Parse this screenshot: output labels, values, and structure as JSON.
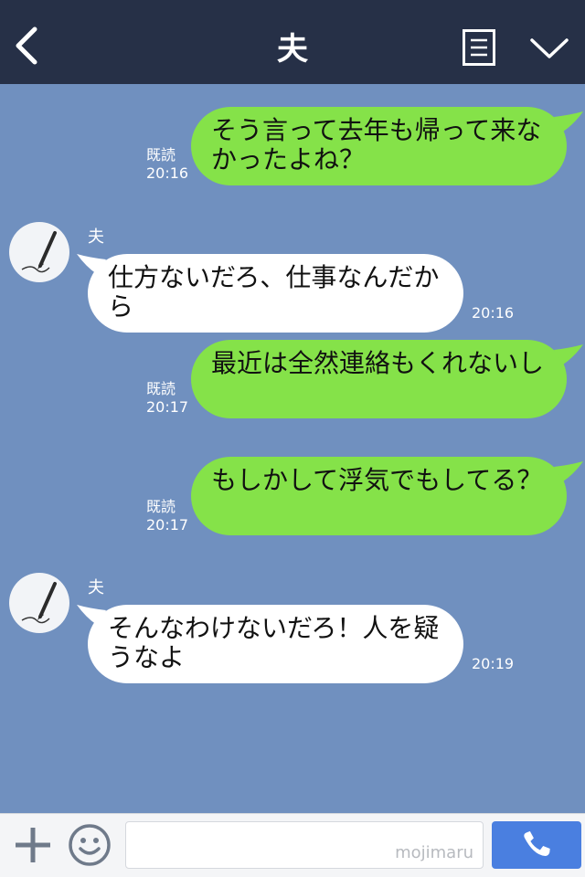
{
  "header": {
    "title": "夫"
  },
  "messages": [
    {
      "text": "そう言って去年も帰って来なかったよね？",
      "read": "既読",
      "time": "20:16"
    },
    {
      "sender": "夫",
      "text": "仕方ないだろ、仕事なんだから",
      "time": "20:16"
    },
    {
      "text": "最近は全然連絡もくれないし",
      "read": "既読",
      "time": "20:17"
    },
    {
      "text": "もしかして浮気でもしてる？",
      "read": "既読",
      "time": "20:17"
    },
    {
      "sender": "夫",
      "text": "そんなわけないだろ！人を疑うなよ",
      "time": "20:19"
    }
  ],
  "input": {
    "watermark": "mojimaru"
  },
  "colors": {
    "header": "#263047",
    "background": "#7090bf",
    "sent_bubble": "#85e249",
    "received_bubble": "#ffffff",
    "call_button": "#4a7fe0"
  },
  "icons": [
    "back-chevron-icon",
    "list-menu-icon",
    "chevron-down-icon",
    "plus-icon",
    "smile-icon",
    "phone-icon",
    "avatar-pen-icon"
  ]
}
